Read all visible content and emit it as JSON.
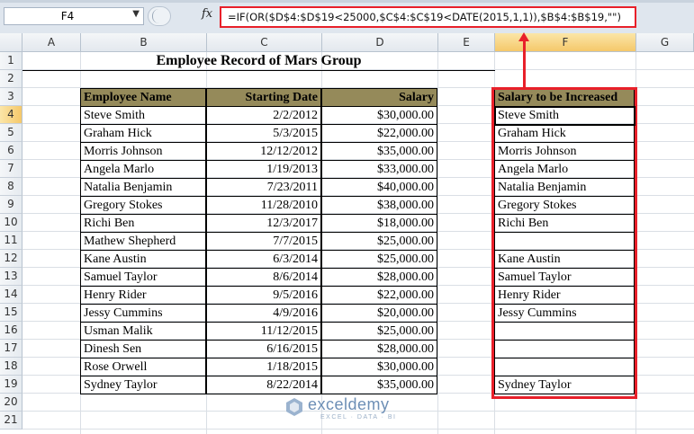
{
  "formula_bar": {
    "name_box": "F4",
    "fx_label": "fx",
    "formula": "=IF(OR($D$4:$D$19<25000,$C$4:$C$19<DATE(2015,1,1)),$B$4:$B$19,\"\")"
  },
  "columns": [
    "A",
    "B",
    "C",
    "D",
    "E",
    "F",
    "G"
  ],
  "rows": [
    "1",
    "2",
    "3",
    "4",
    "5",
    "6",
    "7",
    "8",
    "9",
    "10",
    "11",
    "12",
    "13",
    "14",
    "15",
    "16",
    "17",
    "18",
    "19",
    "20",
    "21"
  ],
  "sheet": {
    "title": "Employee Record of Mars Group",
    "headers": {
      "name": "Employee Name",
      "date": "Starting Date",
      "salary": "Salary",
      "increase": "Salary to be Increased"
    },
    "records": [
      {
        "name": "Steve Smith",
        "date": "2/2/2012",
        "salary": "$30,000.00",
        "increase": "Steve Smith"
      },
      {
        "name": "Graham Hick",
        "date": "5/3/2015",
        "salary": "$22,000.00",
        "increase": "Graham Hick"
      },
      {
        "name": "Morris Johnson",
        "date": "12/12/2012",
        "salary": "$35,000.00",
        "increase": "Morris Johnson"
      },
      {
        "name": "Angela Marlo",
        "date": "1/19/2013",
        "salary": "$33,000.00",
        "increase": "Angela Marlo"
      },
      {
        "name": "Natalia Benjamin",
        "date": "7/23/2011",
        "salary": "$40,000.00",
        "increase": "Natalia Benjamin"
      },
      {
        "name": "Gregory Stokes",
        "date": "11/28/2010",
        "salary": "$38,000.00",
        "increase": "Gregory Stokes"
      },
      {
        "name": "Richi Ben",
        "date": "12/3/2017",
        "salary": "$18,000.00",
        "increase": "Richi Ben"
      },
      {
        "name": "Mathew Shepherd",
        "date": "7/7/2015",
        "salary": "$25,000.00",
        "increase": ""
      },
      {
        "name": "Kane Austin",
        "date": "6/3/2014",
        "salary": "$25,000.00",
        "increase": "Kane Austin"
      },
      {
        "name": "Samuel Taylor",
        "date": "8/6/2014",
        "salary": "$28,000.00",
        "increase": "Samuel Taylor"
      },
      {
        "name": "Henry Rider",
        "date": "9/5/2016",
        "salary": "$22,000.00",
        "increase": "Henry Rider"
      },
      {
        "name": "Jessy Cummins",
        "date": "4/9/2016",
        "salary": "$20,000.00",
        "increase": "Jessy Cummins"
      },
      {
        "name": "Usman Malik",
        "date": "11/12/2015",
        "salary": "$25,000.00",
        "increase": ""
      },
      {
        "name": "Dinesh Sen",
        "date": "6/16/2015",
        "salary": "$28,000.00",
        "increase": ""
      },
      {
        "name": "Rose Orwell",
        "date": "1/18/2015",
        "salary": "$30,000.00",
        "increase": ""
      },
      {
        "name": "Sydney Taylor",
        "date": "8/22/2014",
        "salary": "$35,000.00",
        "increase": "Sydney Taylor"
      }
    ]
  },
  "watermark": {
    "brand": "exceldemy",
    "tagline": "EXCEL · DATA · BI"
  },
  "colors": {
    "header_fill": "#958a5a",
    "highlight": "#e8202a",
    "selected_header": "#f5c86a"
  }
}
